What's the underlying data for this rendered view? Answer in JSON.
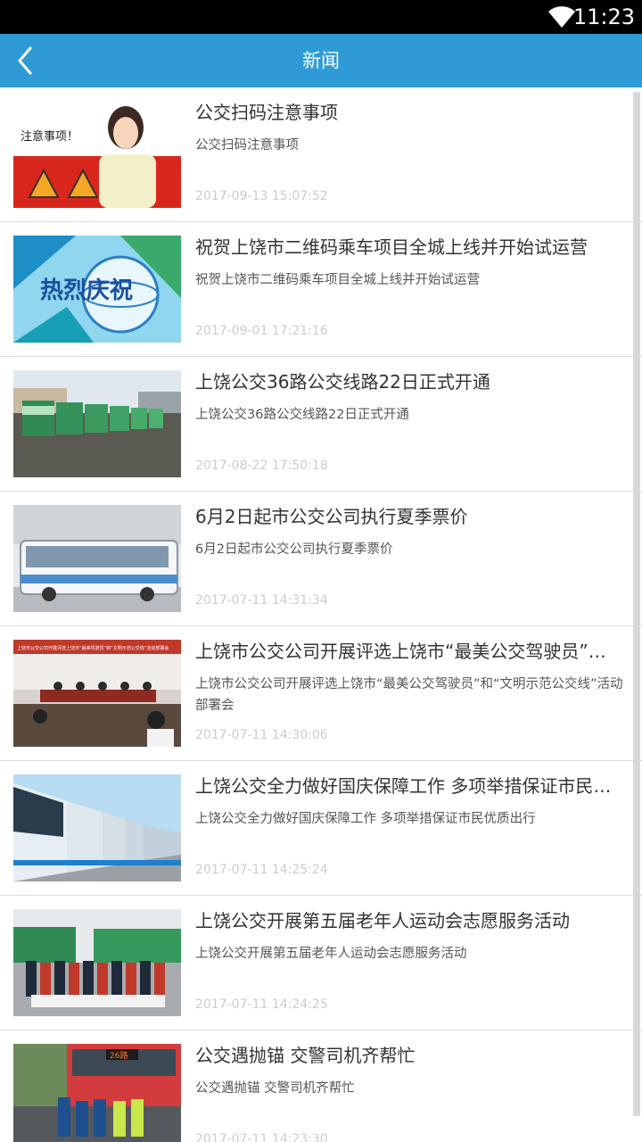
{
  "status_bar": {
    "time": "11:23",
    "wifi_icon": "wifi-icon"
  },
  "header": {
    "title": "新闻",
    "back_icon": "chevron-left-icon",
    "background": "#2e9bd6"
  },
  "news": [
    {
      "title": "公交扫码注意事项",
      "summary": "公交扫码注意事项",
      "date": "2017-09-13 15:07:52",
      "thumb_text": "注意事项！"
    },
    {
      "title": "祝贺上饶市二维码乘车项目全城上线并开始试运营",
      "summary": "祝贺上饶市二维码乘车项目全城上线并开始试运营",
      "date": "2017-09-01 17:21:16",
      "thumb_text": "热烈庆祝"
    },
    {
      "title": "上饶公交36路公交线路22日正式开通",
      "summary": "上饶公交36路公交线路22日正式开通",
      "date": "2017-08-22 17:50:18"
    },
    {
      "title": "6月2日起市公交公司执行夏季票价",
      "summary": "6月2日起市公交公司执行夏季票价",
      "date": "2017-07-11 14:31:34"
    },
    {
      "title": " 上饶市公交公司开展评选上饶市“最美公交驾驶员”和“文明示范公交线”活动部署会",
      "summary": " 上饶市公交公司开展评选上饶市“最美公交驾驶员”和“文明示范公交线”活动部署会",
      "date": "2017-07-11 14:30:06",
      "thumb_text": "上饶市公交公司开展评选上饶市“最美驾驶员”和“文明示范公交线”活动部署会"
    },
    {
      "title": "上饶公交全力做好国庆保障工作 多项举措保证市民优质出行",
      "summary": "上饶公交全力做好国庆保障工作 多项举措保证市民优质出行",
      "date": "2017-07-11 14:25:24"
    },
    {
      "title": "上饶公交开展第五届老年人运动会志愿服务活动",
      "summary": "上饶公交开展第五届老年人运动会志愿服务活动",
      "date": "2017-07-11 14:24:25"
    },
    {
      "title": "公交遇抛锚 交警司机齐帮忙",
      "summary": "公交遇抛锚 交警司机齐帮忙",
      "date": "2017-07-11 14:23:30",
      "thumb_text": "26路"
    }
  ]
}
